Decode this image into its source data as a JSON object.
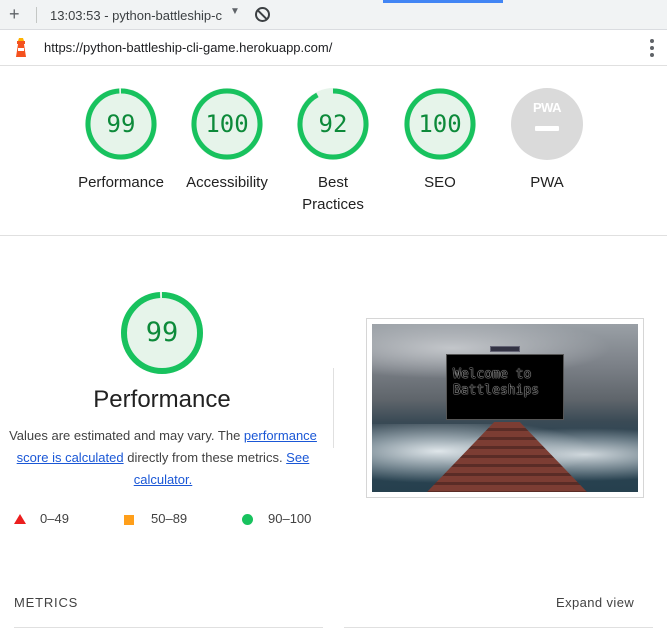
{
  "tab": {
    "new_tab_icon": "plus-icon",
    "title": "13:03:53 - python-battleship-c",
    "dropdown_icon": "caret-down-icon",
    "block_icon": "block-icon"
  },
  "address_bar": {
    "url": "https://python-battleship-cli-game.herokuapp.com/",
    "site_icon": "lighthouse-icon",
    "menu_icon": "kebab-menu-icon"
  },
  "categories": [
    {
      "score": "99",
      "label": "Performance",
      "fraction": 0.99
    },
    {
      "score": "100",
      "label": "Accessibility",
      "fraction": 1.0
    },
    {
      "score": "92",
      "label": "Best Practices",
      "fraction": 0.92
    },
    {
      "score": "100",
      "label": "SEO",
      "fraction": 1.0
    },
    {
      "label": "PWA",
      "badge_text": "PWA"
    }
  ],
  "performance": {
    "score": "99",
    "fraction": 0.99,
    "title": "Performance",
    "desc_prefix": "Values are estimated and may vary. The ",
    "desc_link1": "performance score is calculated",
    "desc_middle": " directly from these metrics. ",
    "desc_link2": "See calculator.",
    "legend": [
      {
        "range": "0–49",
        "shape": "triangle",
        "color": "#eb1e1e"
      },
      {
        "range": "50–89",
        "shape": "square",
        "color": "#ff9f1a"
      },
      {
        "range": "90–100",
        "shape": "circle",
        "color": "#18c25e"
      }
    ]
  },
  "screenshot": {
    "overlay_text": "Welcome to Battleships"
  },
  "metrics": {
    "header": "METRICS",
    "expand_label": "Expand view"
  },
  "colors": {
    "pass_green": "#0d8a3a",
    "ring_green": "#18c25e",
    "ring_bg": "#e6f4ea",
    "link_blue": "#1a57d6"
  }
}
